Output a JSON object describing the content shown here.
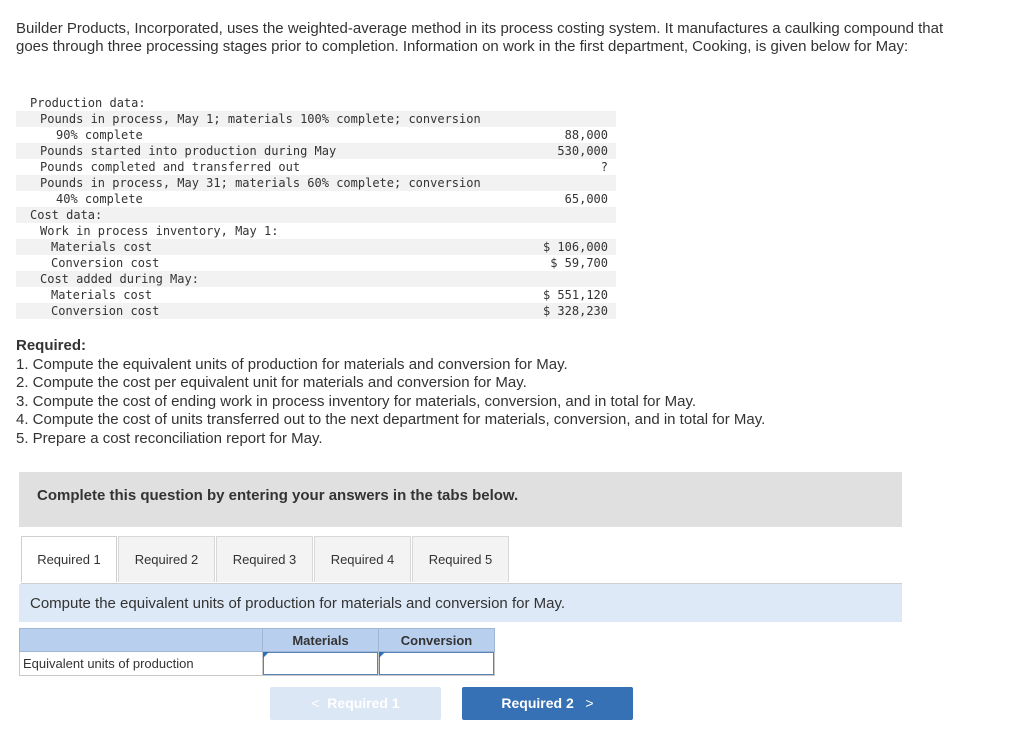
{
  "intro": "Builder Products, Incorporated, uses the weighted-average method in its process costing system. It manufactures a caulking compound that goes through three processing stages prior to completion. Information on work in the first department, Cooking, is given below for May:",
  "production_table": [
    {
      "label": "Production data:",
      "value": "",
      "indent": 0,
      "shade": false
    },
    {
      "label": "Pounds in process, May 1; materials 100% complete; conversion",
      "value": "",
      "indent": 1,
      "shade": true
    },
    {
      "label": "90% complete",
      "value": "88,000",
      "indent": 3,
      "shade": false
    },
    {
      "label": "Pounds started into production during May",
      "value": "530,000",
      "indent": 1,
      "shade": true
    },
    {
      "label": "Pounds completed and transferred out",
      "value": "?",
      "indent": 1,
      "shade": false
    },
    {
      "label": "Pounds in process, May 31; materials 60% complete; conversion",
      "value": "",
      "indent": 1,
      "shade": true
    },
    {
      "label": "40% complete",
      "value": "65,000",
      "indent": 3,
      "shade": false
    },
    {
      "label": "Cost data:",
      "value": "",
      "indent": 0,
      "shade": true
    },
    {
      "label": "Work in process inventory, May 1:",
      "value": "",
      "indent": 1,
      "shade": false
    },
    {
      "label": "Materials cost",
      "value": "$ 106,000",
      "indent": 2,
      "shade": true
    },
    {
      "label": "Conversion cost",
      "value": "$ 59,700",
      "indent": 2,
      "shade": false
    },
    {
      "label": "Cost added during May:",
      "value": "",
      "indent": 1,
      "shade": true
    },
    {
      "label": "Materials cost",
      "value": "$ 551,120",
      "indent": 2,
      "shade": false
    },
    {
      "label": "Conversion cost",
      "value": "$ 328,230",
      "indent": 2,
      "shade": true
    }
  ],
  "required": {
    "title": "Required:",
    "items": [
      "1. Compute the equivalent units of production for materials and conversion for May.",
      "2. Compute the cost per equivalent unit for materials and conversion for May.",
      "3. Compute the cost of ending work in process inventory for materials, conversion, and in total for May.",
      "4. Compute the cost of units transferred out to the next department for materials, conversion, and in total for May.",
      "5. Prepare a cost reconciliation report for May."
    ]
  },
  "banner": "Complete this question by entering your answers in the tabs below.",
  "tabs": [
    {
      "label": "Required 1",
      "active": true
    },
    {
      "label": "Required 2",
      "active": false
    },
    {
      "label": "Required 3",
      "active": false
    },
    {
      "label": "Required 4",
      "active": false
    },
    {
      "label": "Required 5",
      "active": false
    }
  ],
  "instruction": "Compute the equivalent units of production for materials and conversion for May.",
  "answer_table": {
    "headers": [
      "",
      "Materials",
      "Conversion"
    ],
    "row_label": "Equivalent units of production",
    "materials_value": "",
    "conversion_value": ""
  },
  "nav": {
    "prev_label": "Required 1",
    "next_label": "Required 2",
    "prev_chevron": "<",
    "next_chevron": ">"
  },
  "colors": {
    "banner_bg": "#e0e0e0",
    "instruction_bg": "#dde9f6",
    "header_bg": "#b9cfee",
    "next_button": "#3670b5",
    "prev_button": "#dce7f5"
  }
}
